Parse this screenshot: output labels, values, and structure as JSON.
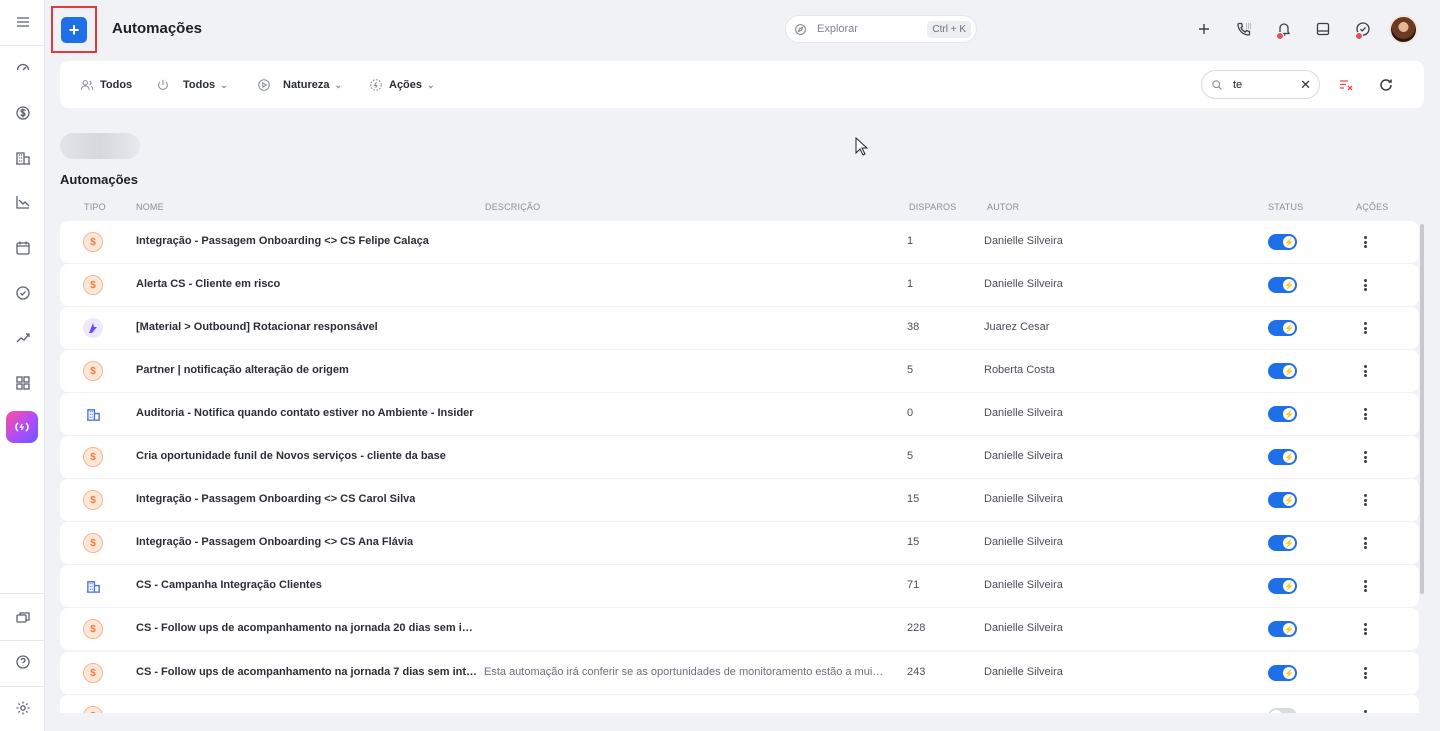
{
  "header": {
    "add_label": "+",
    "title": "Automações",
    "explore_placeholder": "Explorar",
    "explore_shortcut": "Ctrl + K"
  },
  "filters": {
    "owner": "Todos",
    "status": "Todos",
    "nature": "Natureza",
    "actions": "Ações",
    "search_value": "te"
  },
  "section_title": "Automações",
  "columns": {
    "type": "TIPO",
    "name": "NOME",
    "description": "DESCRIÇÃO",
    "triggers": "DISPAROS",
    "author": "AUTOR",
    "status": "STATUS",
    "actions": "AÇÕES"
  },
  "rows": [
    {
      "type": "money-icon",
      "name": "Integração - Passagem Onboarding <> CS Felipe Calaça",
      "description": "",
      "triggers": "1",
      "author": "Danielle Silveira",
      "active": true
    },
    {
      "type": "money-icon",
      "name": "Alerta CS - Cliente em risco",
      "description": "",
      "triggers": "1",
      "author": "Danielle Silveira",
      "active": true
    },
    {
      "type": "rd-icon",
      "name": "[Material > Outbound] Rotacionar responsável",
      "description": "",
      "triggers": "38",
      "author": "Juarez Cesar",
      "active": true
    },
    {
      "type": "money-icon",
      "name": "Partner | notificação alteração de origem",
      "description": "",
      "triggers": "5",
      "author": "Roberta Costa",
      "active": true
    },
    {
      "type": "building-icon",
      "name": "Auditoria - Notifica quando contato estiver no Ambiente - Insider",
      "description": "",
      "triggers": "0",
      "author": "Danielle Silveira",
      "active": true
    },
    {
      "type": "money-icon",
      "name": "Cria oportunidade funil de Novos serviços - cliente da base",
      "description": "",
      "triggers": "5",
      "author": "Danielle Silveira",
      "active": true
    },
    {
      "type": "money-icon",
      "name": "Integração - Passagem Onboarding <> CS Carol Silva",
      "description": "",
      "triggers": "15",
      "author": "Danielle Silveira",
      "active": true
    },
    {
      "type": "money-icon",
      "name": "Integração - Passagem Onboarding <> CS Ana Flávia",
      "description": "",
      "triggers": "15",
      "author": "Danielle Silveira",
      "active": true
    },
    {
      "type": "building-icon",
      "name": "CS - Campanha Integração Clientes",
      "description": "",
      "triggers": "71",
      "author": "Danielle Silveira",
      "active": true
    },
    {
      "type": "money-icon",
      "name": "CS - Follow ups de acompanhamento na jornada 20 dias sem in…",
      "description": "",
      "triggers": "228",
      "author": "Danielle Silveira",
      "active": true
    },
    {
      "type": "money-icon",
      "name": "CS - Follow ups de acompanhamento na jornada 7 dias sem int…",
      "description": "Esta automação irá conferir se as oportunidades de monitoramento estão a mui…",
      "triggers": "243",
      "author": "Danielle Silveira",
      "active": true
    },
    {
      "type": "money-icon",
      "name": "",
      "description": "",
      "triggers": "",
      "author": "",
      "active": false
    }
  ],
  "colors": {
    "accent": "#1f6fe8",
    "highlight": "#e0393e",
    "money_icon": "#ef7b38",
    "building_icon": "#3e6fe0"
  }
}
